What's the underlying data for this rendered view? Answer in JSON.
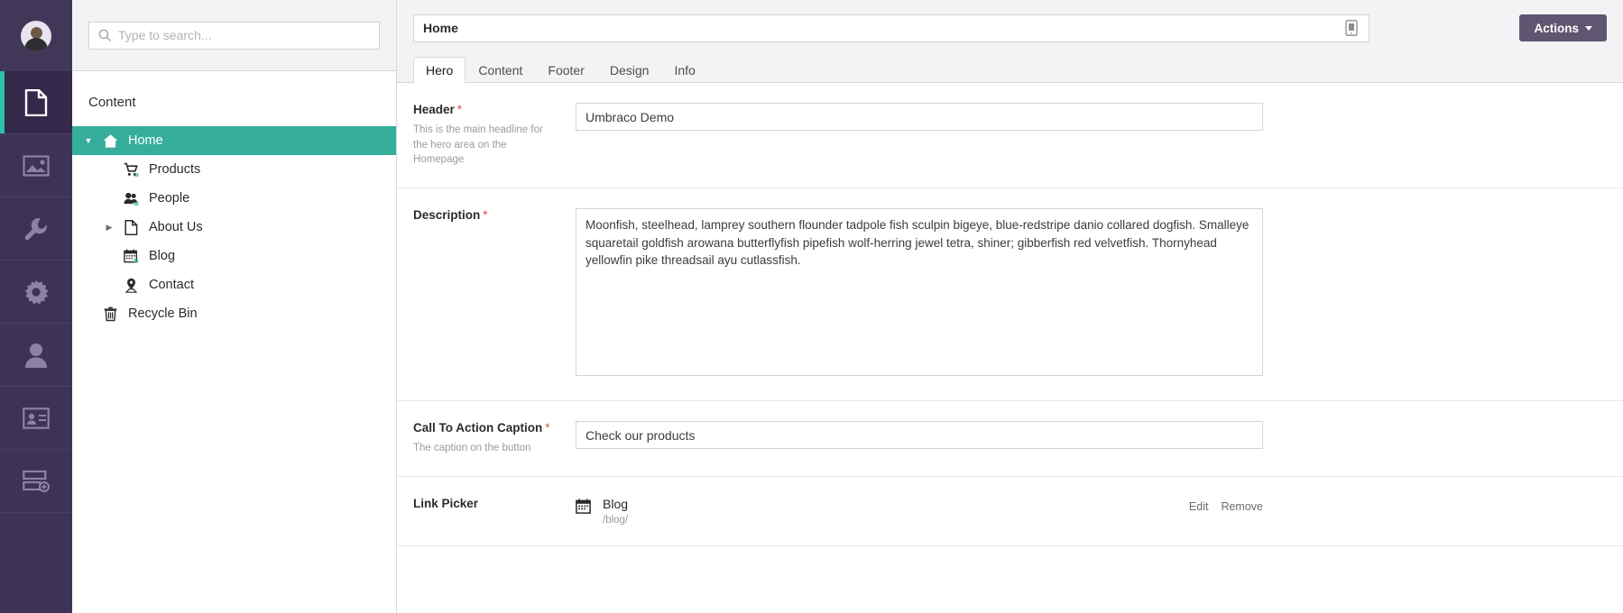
{
  "rail": {
    "avatar_name": "user-avatar",
    "items": [
      {
        "icon": "content-document-icon",
        "name": "sidebar-section-content",
        "active": true
      },
      {
        "icon": "media-image-icon",
        "name": "sidebar-section-media",
        "active": false
      },
      {
        "icon": "settings-wrench-icon",
        "name": "sidebar-section-settings",
        "active": false
      },
      {
        "icon": "developer-gear-icon",
        "name": "sidebar-section-developer",
        "active": false
      },
      {
        "icon": "users-person-icon",
        "name": "sidebar-section-users",
        "active": false
      },
      {
        "icon": "members-card-icon",
        "name": "sidebar-section-members",
        "active": false
      },
      {
        "icon": "forms-icon",
        "name": "sidebar-section-forms",
        "active": false
      }
    ]
  },
  "search": {
    "placeholder": "Type to search...",
    "value": ""
  },
  "tree": {
    "title": "Content",
    "nodes": [
      {
        "label": "Home",
        "icon": "home-icon",
        "level": 0,
        "caret": "down",
        "selected": true
      },
      {
        "label": "Products",
        "icon": "cart-icon",
        "level": 1,
        "caret": "none",
        "selected": false
      },
      {
        "label": "People",
        "icon": "people-icon",
        "level": 1,
        "caret": "none",
        "selected": false
      },
      {
        "label": "About Us",
        "icon": "document-icon",
        "level": 1,
        "caret": "right",
        "selected": false
      },
      {
        "label": "Blog",
        "icon": "calendar-icon",
        "level": 1,
        "caret": "none",
        "selected": false
      },
      {
        "label": "Contact",
        "icon": "map-pin-icon",
        "level": 1,
        "caret": "none",
        "selected": false
      },
      {
        "label": "Recycle Bin",
        "icon": "trash-icon",
        "level": 0,
        "caret": "none",
        "selected": false
      }
    ]
  },
  "header": {
    "node_name": "Home",
    "device_preview_icon": "device-preview-icon",
    "actions_label": "Actions",
    "tabs": [
      {
        "label": "Hero",
        "active": true
      },
      {
        "label": "Content",
        "active": false
      },
      {
        "label": "Footer",
        "active": false
      },
      {
        "label": "Design",
        "active": false
      },
      {
        "label": "Info",
        "active": false
      }
    ]
  },
  "form": {
    "header_field": {
      "label": "Header",
      "required": "*",
      "description": "This is the main headline for the hero area on the Homepage",
      "value": "Umbraco Demo"
    },
    "description_field": {
      "label": "Description",
      "required": "*",
      "description": "",
      "value": "Moonfish, steelhead, lamprey southern flounder tadpole fish sculpin bigeye, blue-redstripe danio collared dogfish. Smalleye squaretail goldfish arowana butterflyfish pipefish wolf-herring jewel tetra, shiner; gibberfish red velvetfish. Thornyhead yellowfin pike threadsail ayu cutlassfish."
    },
    "cta_field": {
      "label": "Call To Action Caption",
      "required": "*",
      "description": "The caption on the button",
      "value": "Check our products"
    },
    "link_picker": {
      "label": "Link Picker",
      "required": "",
      "description": "",
      "item_name": "Blog",
      "item_url": "/blog/",
      "item_icon": "calendar-icon",
      "edit_label": "Edit",
      "remove_label": "Remove"
    }
  },
  "colors": {
    "rail_bg": "#3d3357",
    "rail_active": "#34294b",
    "accent_teal": "#35ae9b",
    "actions_btn": "#615671",
    "required_red": "#d9534f"
  }
}
